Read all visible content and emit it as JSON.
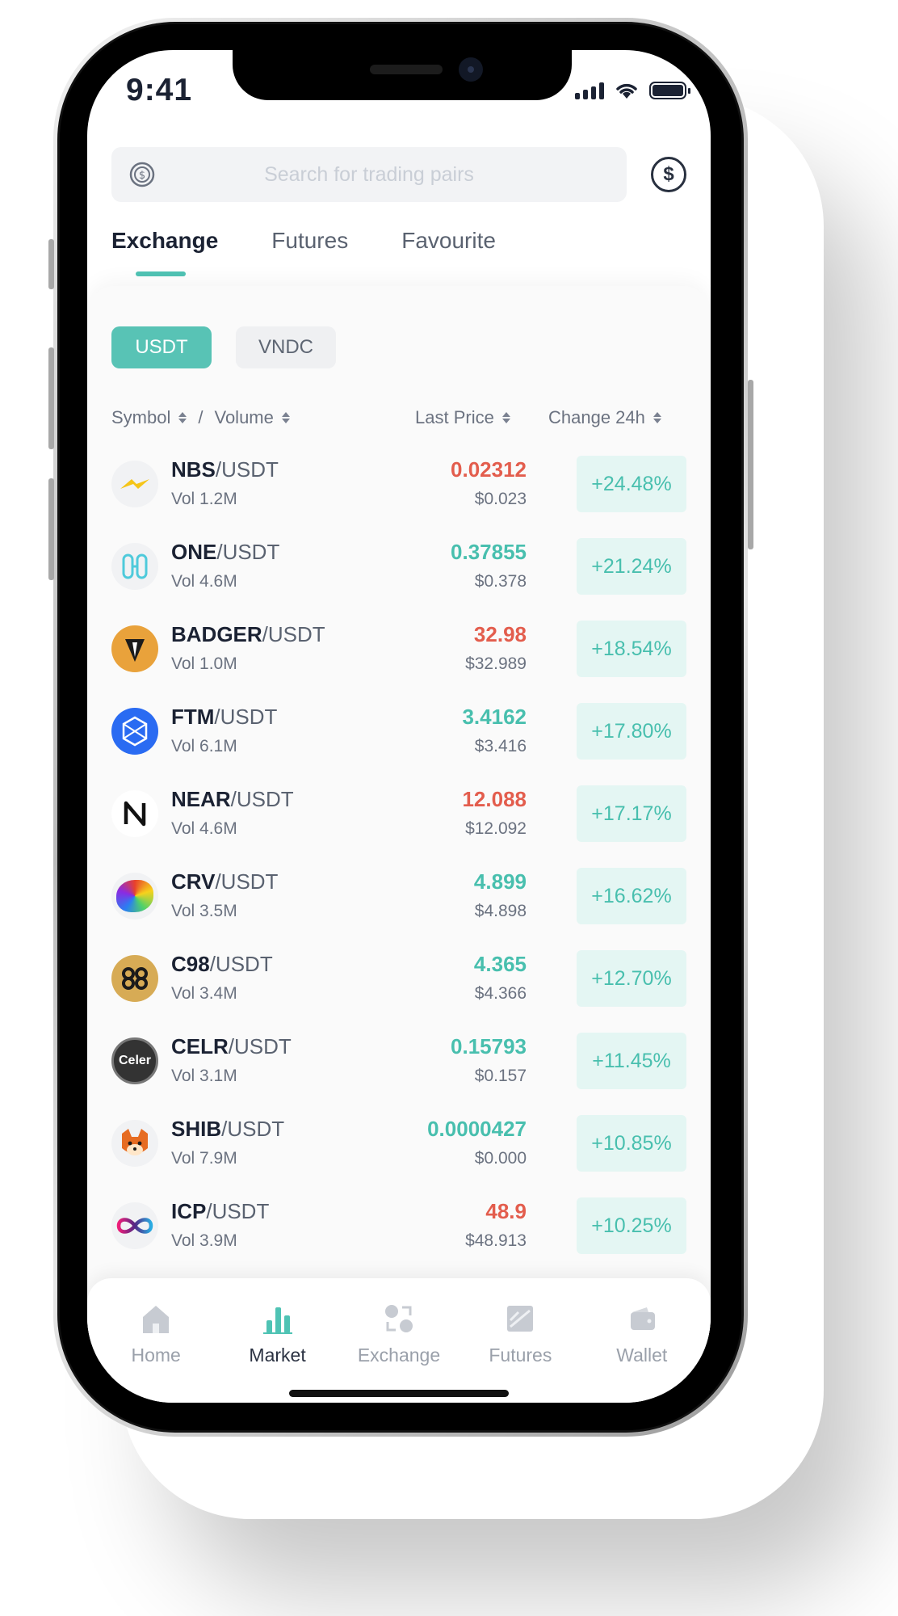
{
  "status_bar": {
    "time": "9:41"
  },
  "search": {
    "placeholder": "Search for trading pairs"
  },
  "tabs": [
    {
      "label": "Exchange",
      "active": true
    },
    {
      "label": "Futures",
      "active": false
    },
    {
      "label": "Favourite",
      "active": false
    }
  ],
  "chips": [
    {
      "label": "USDT",
      "active": true
    },
    {
      "label": "VNDC",
      "active": false
    }
  ],
  "columns": {
    "symbol": "Symbol",
    "separator": "/",
    "volume": "Volume",
    "last_price": "Last Price",
    "change": "Change 24h"
  },
  "pairs": [
    {
      "base": "NBS",
      "quote": "/USDT",
      "vol": "Vol 1.2M",
      "price": "0.02312",
      "usd": "$0.023",
      "change": "+24.48%",
      "trend": "red",
      "icon": "nbs-icon"
    },
    {
      "base": "ONE",
      "quote": "/USDT",
      "vol": "Vol 4.6M",
      "price": "0.37855",
      "usd": "$0.378",
      "change": "+21.24%",
      "trend": "green",
      "icon": "harmony-one-icon"
    },
    {
      "base": "BADGER",
      "quote": "/USDT",
      "vol": "Vol 1.0M",
      "price": "32.98",
      "usd": "$32.989",
      "change": "+18.54%",
      "trend": "red",
      "icon": "badger-icon"
    },
    {
      "base": "FTM",
      "quote": "/USDT",
      "vol": "Vol 6.1M",
      "price": "3.4162",
      "usd": "$3.416",
      "change": "+17.80%",
      "trend": "green",
      "icon": "fantom-icon"
    },
    {
      "base": "NEAR",
      "quote": "/USDT",
      "vol": "Vol 4.6M",
      "price": "12.088",
      "usd": "$12.092",
      "change": "+17.17%",
      "trend": "red",
      "icon": "near-icon"
    },
    {
      "base": "CRV",
      "quote": "/USDT",
      "vol": "Vol 3.5M",
      "price": "4.899",
      "usd": "$4.898",
      "change": "+16.62%",
      "trend": "green",
      "icon": "curve-icon"
    },
    {
      "base": "C98",
      "quote": "/USDT",
      "vol": "Vol 3.4M",
      "price": "4.365",
      "usd": "$4.366",
      "change": "+12.70%",
      "trend": "green",
      "icon": "coin98-icon"
    },
    {
      "base": "CELR",
      "quote": "/USDT",
      "vol": "Vol 3.1M",
      "price": "0.15793",
      "usd": "$0.157",
      "change": "+11.45%",
      "trend": "green",
      "icon": "celer-icon",
      "icon_text": "Celer"
    },
    {
      "base": "SHIB",
      "quote": "/USDT",
      "vol": "Vol 7.9M",
      "price": "0.0000427",
      "usd": "$0.000",
      "change": "+10.85%",
      "trend": "green",
      "icon": "shiba-icon"
    },
    {
      "base": "ICP",
      "quote": "/USDT",
      "vol": "Vol 3.9M",
      "price": "48.9",
      "usd": "$48.913",
      "change": "+10.25%",
      "trend": "red",
      "icon": "icp-infinity-icon"
    }
  ],
  "colors": {
    "accent": "#4fc3b4",
    "red": "#e35d4d",
    "green": "#48bfae",
    "change_bg": "#e4f6f3"
  },
  "bottom_nav": [
    {
      "label": "Home",
      "icon": "home-icon",
      "active": false
    },
    {
      "label": "Market",
      "icon": "bar-chart-icon",
      "active": true
    },
    {
      "label": "Exchange",
      "icon": "exchange-icon",
      "active": false
    },
    {
      "label": "Futures",
      "icon": "futures-icon",
      "active": false
    },
    {
      "label": "Wallet",
      "icon": "wallet-icon",
      "active": false
    }
  ]
}
